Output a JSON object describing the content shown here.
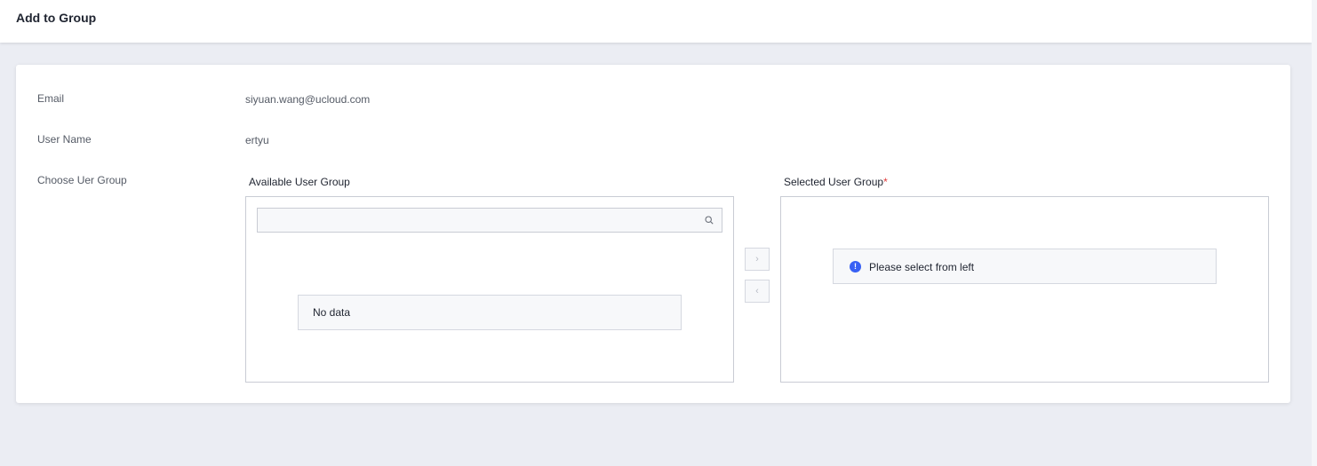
{
  "header": {
    "title": "Add to Group"
  },
  "form": {
    "email_label": "Email",
    "email_value": "siyuan.wang@ucloud.com",
    "username_label": "User Name",
    "username_value": "ertyu",
    "group_label": "Choose Uer Group"
  },
  "transfer": {
    "available_title": "Available User Group",
    "selected_title": "Selected User Group",
    "required_mark": "*",
    "search_placeholder": "",
    "search_value": "",
    "empty_text": "No data",
    "selected_hint": "Please select from left",
    "move_right_glyph": "›",
    "move_left_glyph": "‹",
    "info_glyph": "!"
  },
  "colors": {
    "accent": "#3860f4",
    "required": "#e03b3b",
    "background": "#ebedf3"
  }
}
